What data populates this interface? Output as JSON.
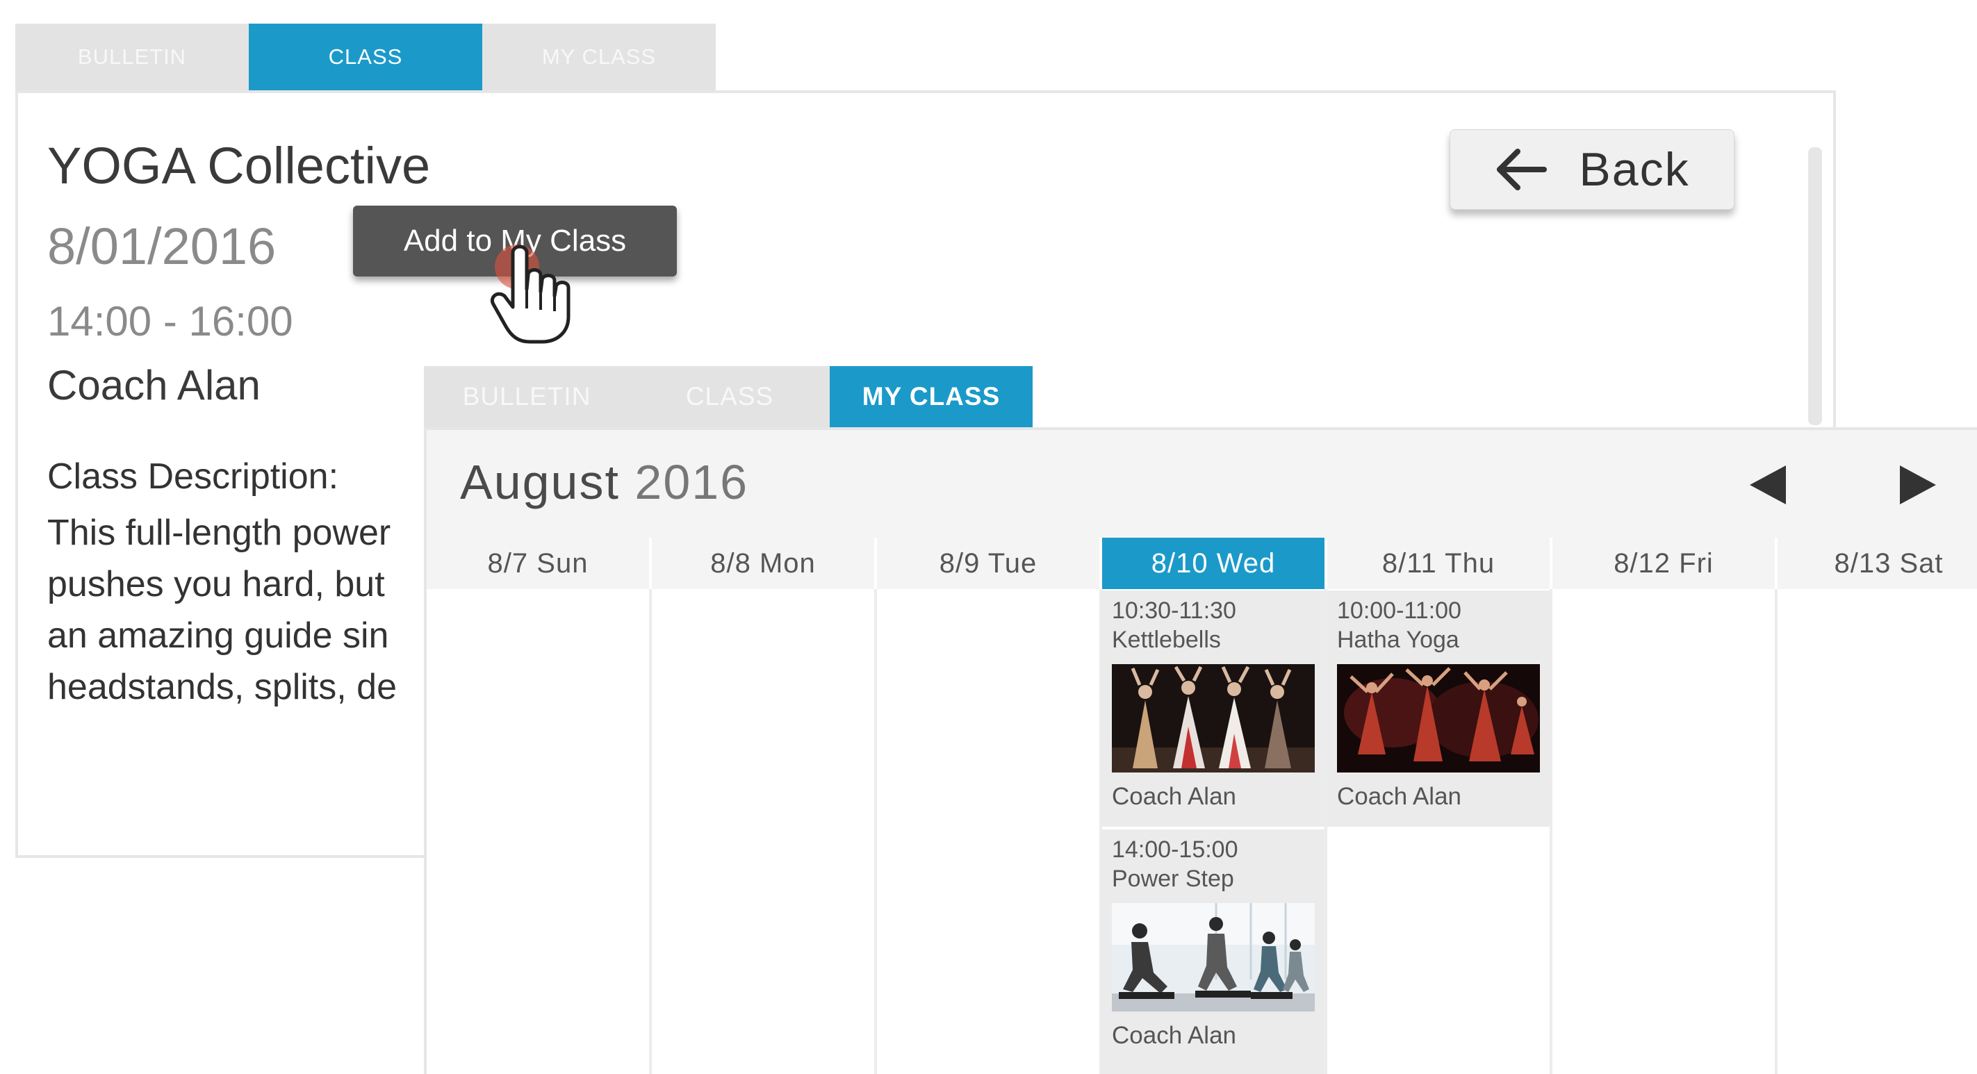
{
  "back_window": {
    "tabs": [
      {
        "label": "BULLETIN",
        "active": false
      },
      {
        "label": "CLASS",
        "active": true
      },
      {
        "label": "MY CLASS",
        "active": false
      }
    ],
    "class_title": "YOGA Collective",
    "date": "8/01/2016",
    "time": "14:00 - 16:00",
    "coach": "Coach Alan",
    "description_heading": "Class Description:",
    "description_lines": [
      "This full-length power",
      "pushes you hard, but",
      "an amazing guide sin",
      "headstands, splits, de"
    ],
    "add_button_label": "Add to My Class",
    "back_button_label": "Back"
  },
  "front_window": {
    "tabs": [
      {
        "label": "BULLETIN",
        "active": false
      },
      {
        "label": "CLASS",
        "active": false
      },
      {
        "label": "MY CLASS",
        "active": true
      }
    ],
    "month": "August",
    "year": "2016",
    "days": [
      "8/7 Sun",
      "8/8 Mon",
      "8/9 Tue",
      "8/10 Wed",
      "8/11 Thu",
      "8/12 Fri",
      "8/13 Sat"
    ],
    "today_index": 3,
    "events": [
      {
        "day_index": 3,
        "time": "10:30-11:30",
        "name": "Kettlebells",
        "coach": "Coach Alan",
        "image": "dance-photo"
      },
      {
        "day_index": 4,
        "time": "10:00-11:00",
        "name": "Hatha Yoga",
        "coach": "Coach Alan",
        "image": "performance-photo"
      },
      {
        "day_index": 3,
        "time": "14:00-15:00",
        "name": "Power Step",
        "coach": "Coach Alan",
        "image": "step-class-photo"
      }
    ]
  },
  "colors": {
    "accent": "#1b9ac9",
    "inactive_tab": "#e3e3e3",
    "dark_button": "#555555"
  }
}
